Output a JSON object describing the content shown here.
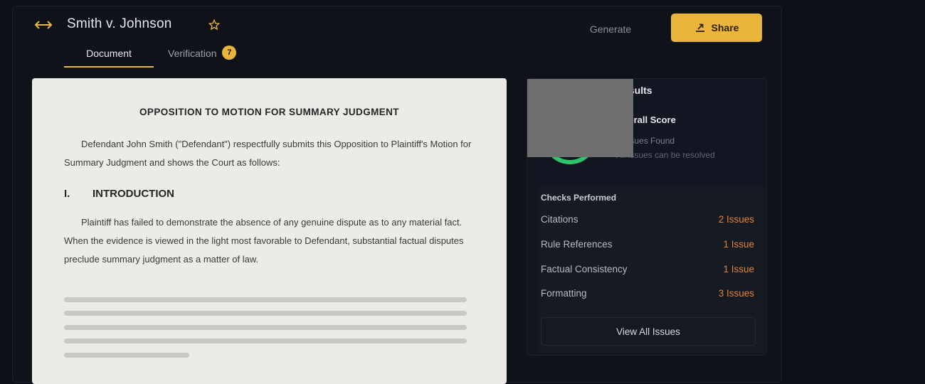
{
  "header": {
    "title": "Smith v. Johnson",
    "generate_label": "Generate",
    "share_label": "Share"
  },
  "tabs": [
    {
      "label": "Document",
      "active": true
    },
    {
      "label": "Verification",
      "badge": "7"
    }
  ],
  "document": {
    "title": "OPPOSITION TO MOTION FOR SUMMARY JUDGMENT",
    "intro_paragraph": "Defendant John Smith (\"Defendant\") respectfully submits this Opposition to Plaintiff's Motion for Summary Judgment and shows the Court as follows:",
    "section_number": "I.",
    "section_title": "INTRODUCTION",
    "section_paragraph": "Plaintiff has failed to demonstrate the absence of any genuine dispute as to any material fact. When the evidence is viewed in the light most favorable to Defendant, substantial factual disputes preclude summary judgment as a matter of law."
  },
  "verification": {
    "title": "Results",
    "overall_label": "Overall Score",
    "issues_found": "7 Issues Found",
    "issues_sub": "All issues can be resolved",
    "checks_label": "Checks Performed",
    "checks": [
      {
        "name": "Citations",
        "count": "2 Issues"
      },
      {
        "name": "Rule References",
        "count": "1 Issue"
      },
      {
        "name": "Factual Consistency",
        "count": "1 Issue"
      },
      {
        "name": "Formatting",
        "count": "3 Issues"
      }
    ],
    "view_all_label": "View All Issues"
  },
  "colors": {
    "accent": "#eab43d",
    "score_ring": "#2fc46b",
    "issue_count": "#e0833a"
  }
}
